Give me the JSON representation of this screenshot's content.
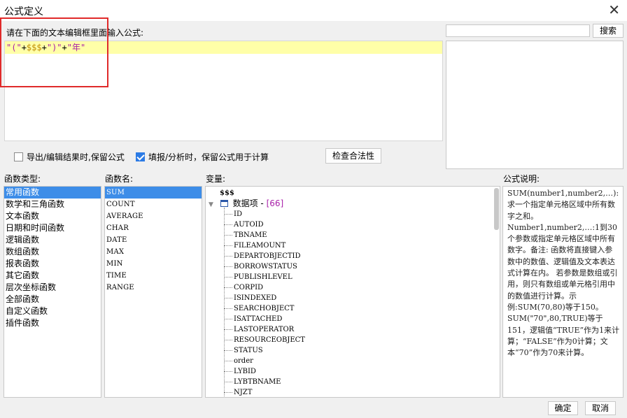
{
  "window": {
    "title": "公式定义"
  },
  "editor": {
    "prompt": "请在下面的文本编辑框里面输入公式:",
    "tokens": [
      "\"(\"",
      "+",
      "$$$",
      "+",
      "\")\"",
      "+",
      "\"年\""
    ]
  },
  "search": {
    "value": "",
    "button": "搜索"
  },
  "options": {
    "export_keep": {
      "label": "导出/编辑结果时,保留公式",
      "checked": false
    },
    "fill_keep": {
      "label": "填报/分析时，保留公式用于计算",
      "checked": true
    },
    "check_button": "检查合法性"
  },
  "labels": {
    "func_type": "函数类型:",
    "func_name": "函数名:",
    "variables": "变量:",
    "description": "公式说明:"
  },
  "func_types": [
    "常用函数",
    "数学和三角函数",
    "文本函数",
    "日期和时间函数",
    "逻辑函数",
    "数组函数",
    "报表函数",
    "其它函数",
    "层次坐标函数",
    "全部函数",
    "自定义函数",
    "插件函数"
  ],
  "func_names": [
    "SUM",
    "COUNT",
    "AVERAGE",
    "CHAR",
    "DATE",
    "MAX",
    "MIN",
    "TIME",
    "RANGE"
  ],
  "variables": {
    "root": "$$$",
    "group_label": "数据项",
    "group_count": "[66]",
    "fields": [
      "ID",
      "AUTOID",
      "TBNAME",
      "FILEAMOUNT",
      "DEPARTOBJECTID",
      "BORROWSTATUS",
      "PUBLISHLEVEL",
      "CORPID",
      "ISINDEXED",
      "SEARCHOBJECT",
      "ISATTACHED",
      "LASTOPERATOR",
      "RESOURCEOBJECT",
      "STATUS",
      "order",
      "LYBID",
      "LYBTBNAME",
      "NJZT"
    ]
  },
  "description": "SUM(number1,number2,…): 求一个指定单元格区域中所有数字之和。Number1,number2,…:1到30个参数或指定单元格区域中所有数字。备注: 函数将直接键入参数中的数值、逻辑值及文本表达式计算在内。 若参数是数组或引用，则只有数组或单元格引用中的数值进行计算。示例:SUM(70,80)等于150。SUM(\"70\",80,TRUE)等于151，逻辑值“TRUE”作为1来计算；“FALSE”作为0计算；文本“70”作为70来计算。",
  "footer": {
    "ok": "确定",
    "cancel": "取消"
  },
  "colors": {
    "selection": "#3d8de8",
    "highlight_line": "#ffffa8",
    "string_token": "#a81fa8",
    "variable_token": "#c08a00",
    "annotation_box": "#e02a2a"
  }
}
